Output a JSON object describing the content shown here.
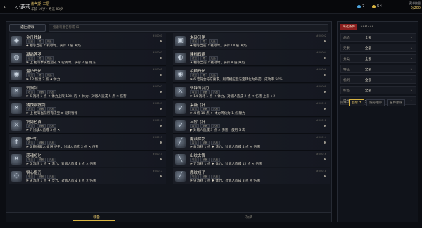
{
  "header": {
    "player_name": "小萝莉",
    "realm": "炼气期 三层",
    "progress": "年龄 16岁 · 寿元 80岁",
    "gems": "7",
    "coins": "54",
    "collect_label": "藏书数量",
    "collect_value": "0/200"
  },
  "toolbar": {
    "clear_label": "返回游戏",
    "search_placeholder": "搜索装备名称或 ID"
  },
  "cards": [
    {
      "title": "金丹残缺",
      "code": "#00001",
      "tags": [
        "法宝",
        "灵",
        "凡品"
      ],
      "icon": "◈",
      "desc": "◆ 相等当前 ♪ 耗尽时，获得 3 层 离焰"
    },
    {
      "title": "朱砂印匣",
      "code": "#00002",
      "tags": [
        "法宝",
        "灵",
        "凡品"
      ],
      "icon": "▣",
      "desc": "◆ 相等当前 ♪ 耗尽时，获得 10 层 离焰"
    },
    {
      "title": "凝霜莲茎",
      "code": "#00003",
      "tags": [
        "法宝",
        "灵",
        "凡品"
      ],
      "icon": "◍",
      "desc": "⟳ 上 相等本属性造成 ⟳ 轮转时，获得 2 层 霜冻"
    },
    {
      "title": "赌档石蟾",
      "code": "#00004",
      "tags": [
        "法宝",
        "灵",
        "凡品"
      ],
      "icon": "◐",
      "desc": "✦ 相等当前 ♪ 耗尽时，获得 8 层 离焰"
    },
    {
      "title": "温炉丹炉",
      "code": "#00005",
      "tags": [
        "法宝",
        "灵",
        "凡品"
      ],
      "icon": "◉",
      "desc": "⟳ 12 恢复 2 点 ♦ 体力"
    },
    {
      "title": "相顾丹炉",
      "code": "#00006",
      "tags": [
        "法宝",
        "灵",
        "凡品"
      ],
      "icon": "◉",
      "desc": "⟳ 6 若符合符方要求，则得相应品法宝转化为丹药，成功率 50%"
    },
    {
      "title": "沉渊剑",
      "code": "#00007",
      "tags": [
        "攻击",
        "武器",
        "凡品"
      ],
      "icon": "✕",
      "desc": "⟳ 6 消耗 1 点 ♦ 体力上限 10% 的 ♦ 体力，对敌人造成 5 点 ✕ 伤害"
    },
    {
      "title": "斩锋刃剑刃",
      "code": "#00008",
      "tags": [
        "攻击",
        "武器",
        "凡品"
      ],
      "icon": "⚔",
      "desc": "⟳ 14 消耗 1 点 ♦ 体力，对敌人造成 2 点 ✕ 伤害 上限 +2"
    },
    {
      "title": "锈蚀铜钱剑",
      "code": "#00009",
      "tags": [
        "攻击",
        "武器",
        "凡品"
      ],
      "icon": "✕",
      "desc": "⟳ 上 相等当前所有法宝 ⟳ 轮转暂停"
    },
    {
      "title": "采薇飞针",
      "code": "#00010",
      "tags": [
        "攻击",
        "武器",
        "凡品"
      ],
      "icon": "➶",
      "desc": "⟳ 4 将 10 点 ♦ 体力转化为 1 点 耐力"
    },
    {
      "title": "铜铸匕首",
      "code": "#00011",
      "tags": [
        "攻击",
        "武器",
        "凡品"
      ],
      "icon": "⚔",
      "desc": "⟳ 7 对敌人造成 3 点 ✕"
    },
    {
      "title": "三阶飞针",
      "code": "#00012",
      "tags": [
        "攻击",
        "武器",
        "凡品"
      ],
      "icon": "➶",
      "desc": "▶ 对敌人造成 3 点 ✕ 伤害，使用 3 次"
    },
    {
      "title": "破甲爪",
      "code": "#00013",
      "tags": [
        "攻击",
        "武器",
        "凡品"
      ],
      "icon": "⋔",
      "desc": "⟳ 6 移除敌人 6 层 护甲，对敌人造成 2 点 ✕ 伤害"
    },
    {
      "title": "魔法探剑",
      "code": "#00014",
      "tags": [
        "攻击",
        "武器",
        "凡品"
      ],
      "icon": "╱",
      "desc": "⟳ 8 消耗 1 点 ♦ 法力，对敌人造成 4 点 ✕ 伤害"
    },
    {
      "title": "惑魂短匕",
      "code": "#00015",
      "tags": [
        "攻击",
        "武器",
        "凡品"
      ],
      "icon": "✕",
      "desc": "⟳ 5 消耗 1 点 ♦ 法力，对敌人造成 3 点 ✕ 伤害"
    },
    {
      "title": "山纹古锋",
      "code": "#00016",
      "tags": [
        "攻击",
        "武器",
        "凡品"
      ],
      "icon": "╲",
      "desc": "⟳ 7 消耗 1 点 ♦ 体力，对敌人造成 12 点 ✕ 伤害"
    },
    {
      "title": "钢心枢刃",
      "code": "#00017",
      "tags": [
        "攻击",
        "武器",
        "凡品"
      ],
      "icon": "◌",
      "desc": "⟳ 9 消耗 1 点 ♦ 灵力，对敌人造成 3 点 ✕ 伤害"
    },
    {
      "title": "鹿纹短子",
      "code": "#00018",
      "tags": [
        "攻击",
        "武器",
        "凡品"
      ],
      "icon": "╱",
      "desc": "⟳ 9 消耗 1 点 ♦ 体力，对敌人造成 8 点 ✕ 伤害"
    }
  ],
  "bottom_tabs": {
    "active": "装备",
    "other": "功法"
  },
  "filter": {
    "label": "筛选条件",
    "count": "333/333",
    "rows": [
      {
        "label": "品阶",
        "value": "全部"
      },
      {
        "label": "元素",
        "value": "全部"
      },
      {
        "label": "分类",
        "value": "全部"
      },
      {
        "label": "特征",
        "value": "全部"
      },
      {
        "label": "机制",
        "value": "全部"
      },
      {
        "label": "标签",
        "value": "全部"
      },
      {
        "label": "属性",
        "value": "全部"
      }
    ],
    "sort_label": "排序",
    "sort_options": [
      "品阶 ↑",
      "编号顺序",
      "名称顺序"
    ]
  }
}
